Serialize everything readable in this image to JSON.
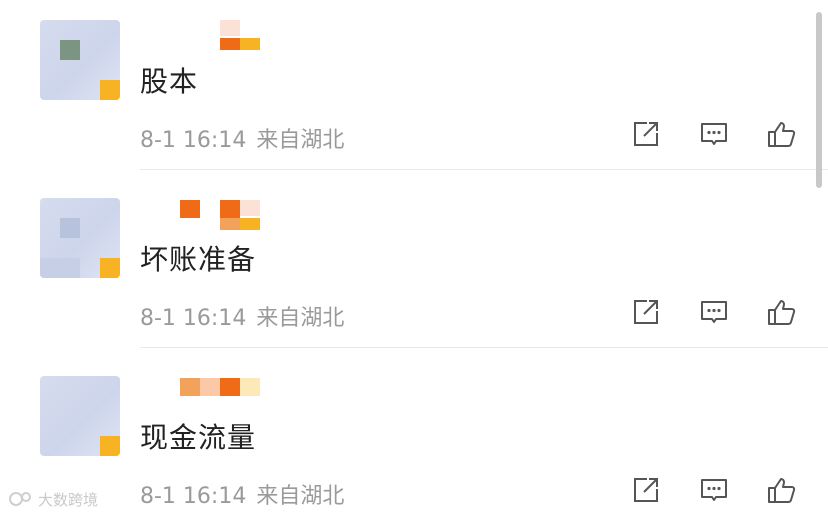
{
  "comments": [
    {
      "text": "股本",
      "date": "8-1 16:14",
      "location": "来自湖北"
    },
    {
      "text": "坏账准备",
      "date": "8-1 16:14",
      "location": "来自湖北"
    },
    {
      "text": "现金流量",
      "date": "8-1 16:14",
      "location": "来自湖北"
    }
  ],
  "icons": {
    "share": "share-icon",
    "reply": "comment-icon",
    "like": "thumbs-up-icon"
  },
  "colors": {
    "text": "#222222",
    "meta": "#9a9a9a",
    "icon": "#555555",
    "mosaic_orange": "#ef6b17",
    "mosaic_amber": "#f7b324"
  },
  "watermark": {
    "text": "大数跨境"
  }
}
